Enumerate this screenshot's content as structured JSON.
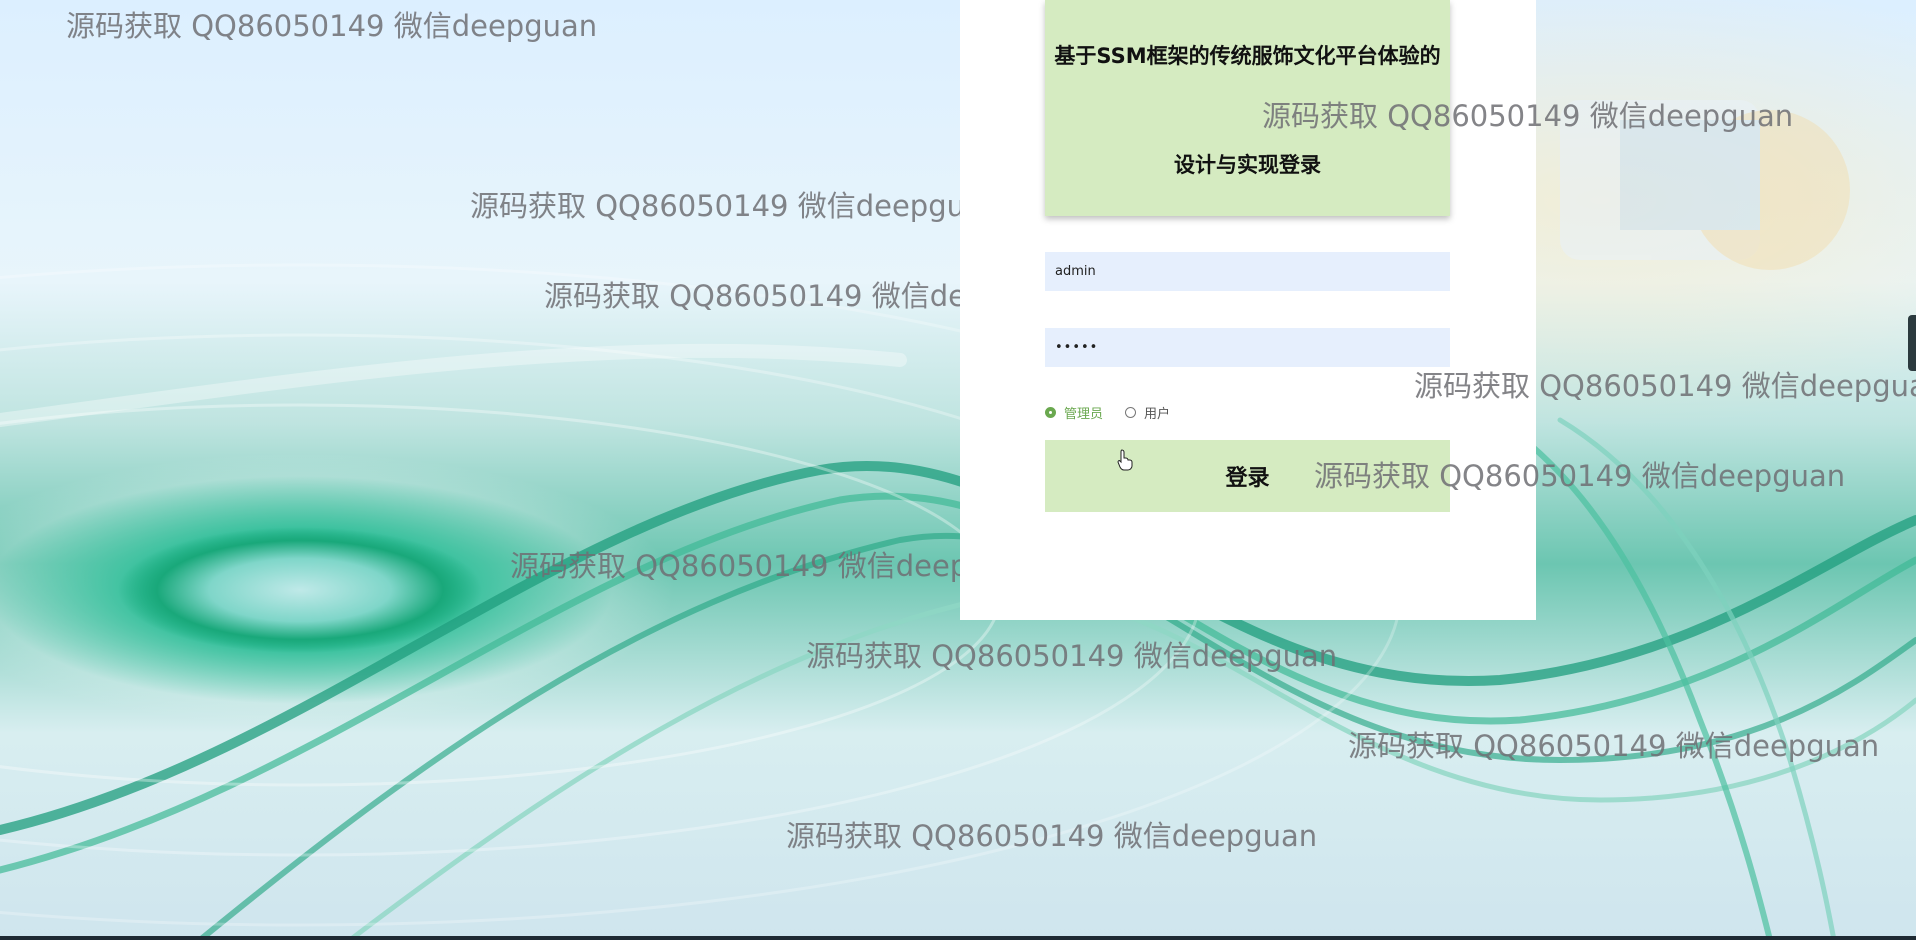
{
  "login": {
    "title_line1": "基于SSM框架的传统服饰文化平台体验的",
    "title_line2": "设计与实现登录",
    "username_value": "admin",
    "password_value": "•••••",
    "roles": [
      {
        "label": "管理员",
        "checked": true
      },
      {
        "label": "用户",
        "checked": false
      }
    ],
    "submit_label": "登录"
  },
  "watermark_text": "源码获取 QQ86050149 微信deepguan",
  "colors": {
    "card": "#ffffff",
    "title_bg": "#d5ebc1",
    "input_bg": "#e6effd",
    "accent_green": "#6aa84f",
    "watermark": "#6e6e73"
  }
}
